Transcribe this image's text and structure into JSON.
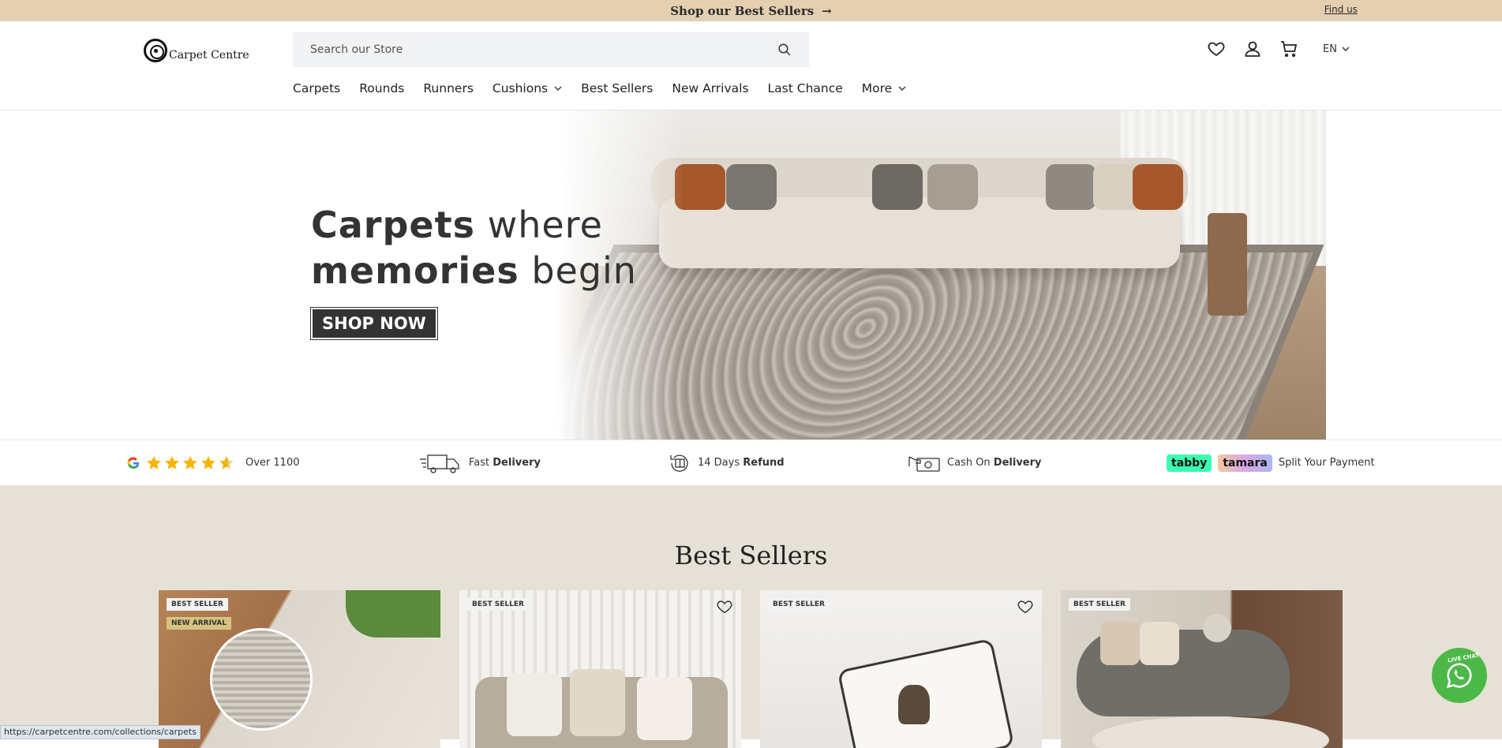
{
  "announcement": {
    "message": "Shop our Best Sellers",
    "arrow": "→",
    "find_us": "Find us"
  },
  "header": {
    "logo_text": "Carpet Centre",
    "search_placeholder": "Search our Store",
    "language": "EN"
  },
  "nav": {
    "items": [
      {
        "label": "Carpets",
        "dropdown": false
      },
      {
        "label": "Rounds",
        "dropdown": false
      },
      {
        "label": "Runners",
        "dropdown": false
      },
      {
        "label": "Cushions",
        "dropdown": true
      },
      {
        "label": "Best Sellers",
        "dropdown": false
      },
      {
        "label": "New Arrivals",
        "dropdown": false
      },
      {
        "label": "Last Chance",
        "dropdown": false
      },
      {
        "label": "More",
        "dropdown": true
      }
    ]
  },
  "hero": {
    "line1_bold": "Carpets",
    "line1_rest": " where",
    "line2_bold": "memories",
    "line2_rest": " begin",
    "cta": "SHOP NOW"
  },
  "trust": {
    "reviews": "Over 1100",
    "delivery_plain": "Fast ",
    "delivery_bold": "Delivery",
    "refund_plain": "14 Days ",
    "refund_bold": "Refund",
    "cod_plain": "Cash On ",
    "cod_bold": "Delivery",
    "tabby": "tabby",
    "tamara": "tamara",
    "split": "Split Your Payment"
  },
  "best_sellers": {
    "title": "Best Sellers",
    "cards": [
      {
        "tag": "BEST SELLER",
        "tag2": "NEW ARRIVAL"
      },
      {
        "tag": "BEST SELLER"
      },
      {
        "tag": "BEST SELLER"
      },
      {
        "tag": "BEST SELLER"
      }
    ]
  },
  "status_url": "https://carpetcentre.com/collections/carpets",
  "whatsapp": {
    "label": "LIVE CHAT"
  },
  "colors": {
    "announce_bg": "#e4cfb1",
    "section_bg": "#e6e1d6",
    "whatsapp": "#4cb848",
    "tabby": "#3bffb1"
  }
}
